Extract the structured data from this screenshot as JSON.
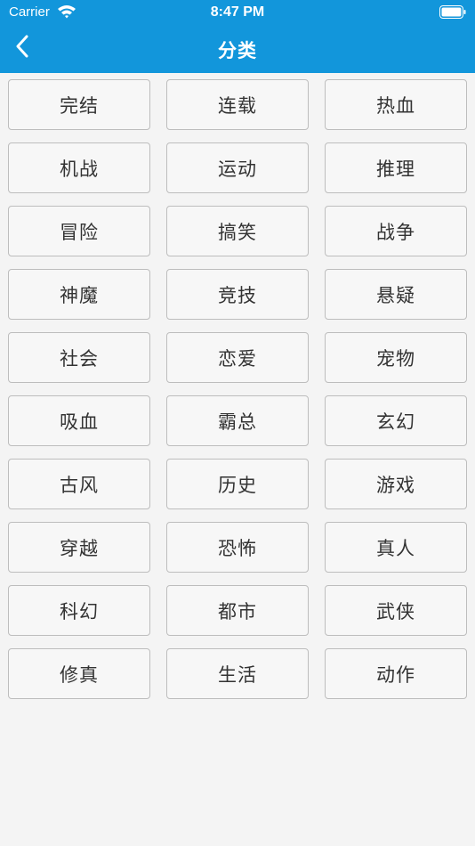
{
  "status_bar": {
    "carrier": "Carrier",
    "time": "8:47 PM",
    "icons": [
      "wifi-icon",
      "battery-icon"
    ]
  },
  "nav": {
    "title": "分类",
    "back_icon": "chevron-left-icon",
    "bg_color": "#1296db"
  },
  "categories": [
    "完结",
    "连载",
    "热血",
    "机战",
    "运动",
    "推理",
    "冒险",
    "搞笑",
    "战争",
    "神魔",
    "竞技",
    "悬疑",
    "社会",
    "恋爱",
    "宠物",
    "吸血",
    "霸总",
    "玄幻",
    "古风",
    "历史",
    "游戏",
    "穿越",
    "恐怖",
    "真人",
    "科幻",
    "都市",
    "武侠",
    "修真",
    "生活",
    "动作"
  ]
}
